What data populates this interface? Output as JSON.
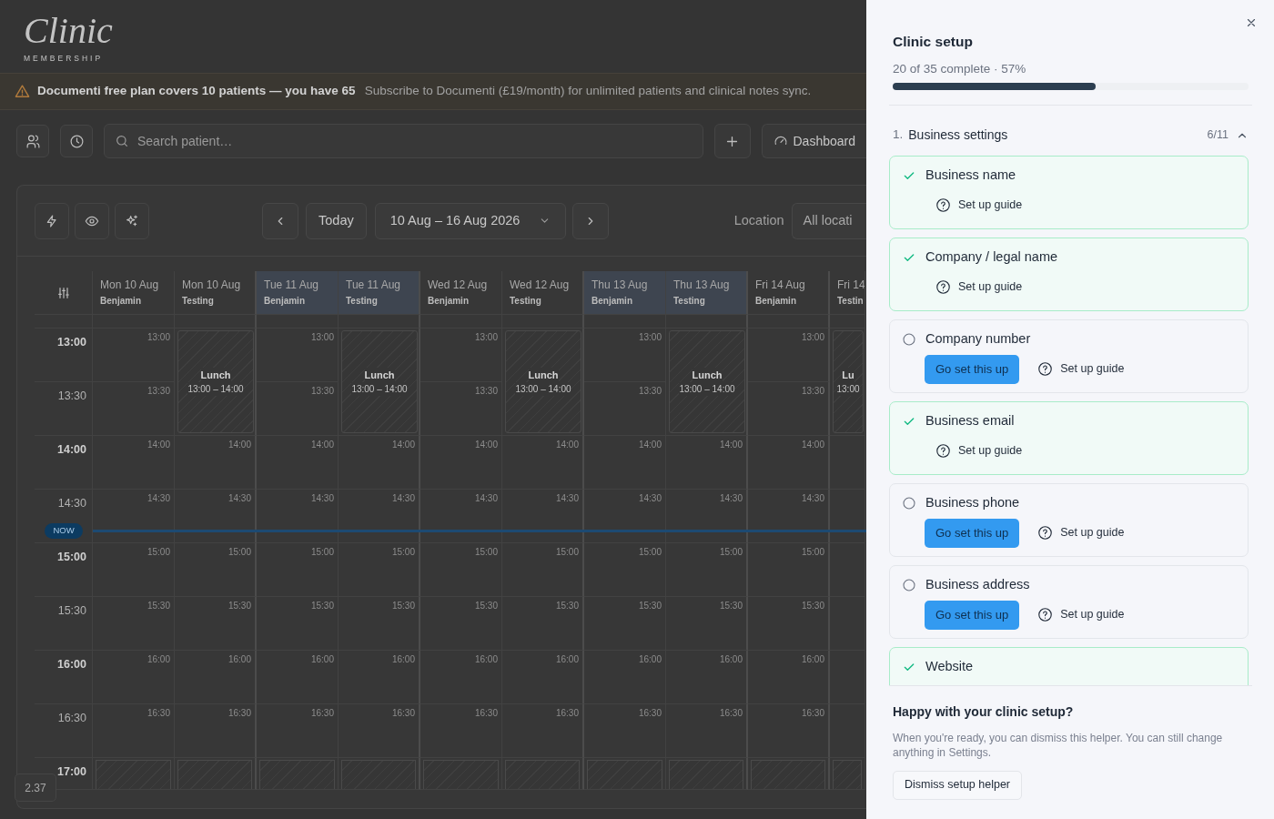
{
  "app": {
    "logo": "Clinic",
    "logo_subtitle": "MEMBERSHIP"
  },
  "banner": {
    "title": "Documenti free plan covers 10 patients — you have 65",
    "message": "Subscribe to Documenti (£19/month) for unlimited patients and clinical notes sync."
  },
  "toolbar": {
    "search": {
      "placeholder": "Search patient…"
    },
    "dashboard_button": "Dashboard"
  },
  "calendar": {
    "today_button": "Today",
    "date_range": "10 Aug – 16 Aug 2026",
    "location_label": "Location",
    "location_value": "All locati",
    "columns": [
      {
        "day": "Mon 10 Aug",
        "person": "Benjamin",
        "shaded": false
      },
      {
        "day": "Mon 10 Aug",
        "person": "Testing",
        "shaded": false
      },
      {
        "day": "Tue 11 Aug",
        "person": "Benjamin",
        "shaded": true
      },
      {
        "day": "Tue 11 Aug",
        "person": "Testing",
        "shaded": true
      },
      {
        "day": "Wed 12 Aug",
        "person": "Benjamin",
        "shaded": false
      },
      {
        "day": "Wed 12 Aug",
        "person": "Testing",
        "shaded": false
      },
      {
        "day": "Thu 13 Aug",
        "person": "Benjamin",
        "shaded": true
      },
      {
        "day": "Thu 13 Aug",
        "person": "Testing",
        "shaded": true
      },
      {
        "day": "Fri 14 Aug",
        "person": "Benjamin",
        "shaded": false
      },
      {
        "day": "Fri 14",
        "person": "Testin",
        "shaded": false
      }
    ],
    "rows": [
      {
        "time": "13:00",
        "major": true,
        "cells": [
          {
            "kind": "free",
            "label": "13:00"
          },
          {
            "kind": "event",
            "title": "Lunch",
            "time": "13:00 – 14:00"
          },
          {
            "kind": "free",
            "label": "13:00"
          },
          {
            "kind": "event",
            "title": "Lunch",
            "time": "13:00 – 14:00"
          },
          {
            "kind": "free",
            "label": "13:00"
          },
          {
            "kind": "event",
            "title": "Lunch",
            "time": "13:00 – 14:00"
          },
          {
            "kind": "free",
            "label": "13:00"
          },
          {
            "kind": "event",
            "title": "Lunch",
            "time": "13:00 – 14:00"
          },
          {
            "kind": "free",
            "label": "13:00"
          },
          {
            "kind": "event",
            "title": "Lu",
            "time": "13:00"
          }
        ]
      },
      {
        "time": "13:30",
        "major": false,
        "cells": [
          {
            "kind": "free",
            "label": "13:30"
          },
          {
            "kind": "covered"
          },
          {
            "kind": "free",
            "label": "13:30"
          },
          {
            "kind": "covered"
          },
          {
            "kind": "free",
            "label": "13:30"
          },
          {
            "kind": "covered"
          },
          {
            "kind": "free",
            "label": "13:30"
          },
          {
            "kind": "covered"
          },
          {
            "kind": "free",
            "label": "13:30"
          },
          {
            "kind": "covered"
          }
        ]
      },
      {
        "time": "14:00",
        "major": true,
        "cells": [
          {
            "kind": "free",
            "label": "14:00"
          },
          {
            "kind": "free",
            "label": "14:00"
          },
          {
            "kind": "free",
            "label": "14:00"
          },
          {
            "kind": "free",
            "label": "14:00"
          },
          {
            "kind": "free",
            "label": "14:00"
          },
          {
            "kind": "free",
            "label": "14:00"
          },
          {
            "kind": "free",
            "label": "14:00"
          },
          {
            "kind": "free",
            "label": "14:00"
          },
          {
            "kind": "free",
            "label": "14:00"
          },
          {
            "kind": "free"
          }
        ]
      },
      {
        "time": "14:30",
        "major": false,
        "now_marker": "NOW",
        "cells": [
          {
            "kind": "free",
            "label": "14:30"
          },
          {
            "kind": "free",
            "label": "14:30"
          },
          {
            "kind": "free",
            "label": "14:30"
          },
          {
            "kind": "free",
            "label": "14:30"
          },
          {
            "kind": "free",
            "label": "14:30"
          },
          {
            "kind": "free",
            "label": "14:30"
          },
          {
            "kind": "free",
            "label": "14:30"
          },
          {
            "kind": "free",
            "label": "14:30"
          },
          {
            "kind": "free",
            "label": "14:30"
          },
          {
            "kind": "free"
          }
        ]
      },
      {
        "time": "15:00",
        "major": true,
        "cells": [
          {
            "kind": "free",
            "label": "15:00"
          },
          {
            "kind": "free",
            "label": "15:00"
          },
          {
            "kind": "free",
            "label": "15:00"
          },
          {
            "kind": "free",
            "label": "15:00"
          },
          {
            "kind": "free",
            "label": "15:00"
          },
          {
            "kind": "free",
            "label": "15:00"
          },
          {
            "kind": "free",
            "label": "15:00"
          },
          {
            "kind": "free",
            "label": "15:00"
          },
          {
            "kind": "free",
            "label": "15:00"
          },
          {
            "kind": "free"
          }
        ]
      },
      {
        "time": "15:30",
        "major": false,
        "cells": [
          {
            "kind": "free",
            "label": "15:30"
          },
          {
            "kind": "free",
            "label": "15:30"
          },
          {
            "kind": "free",
            "label": "15:30"
          },
          {
            "kind": "free",
            "label": "15:30"
          },
          {
            "kind": "free",
            "label": "15:30"
          },
          {
            "kind": "free",
            "label": "15:30"
          },
          {
            "kind": "free",
            "label": "15:30"
          },
          {
            "kind": "free",
            "label": "15:30"
          },
          {
            "kind": "free",
            "label": "15:30"
          },
          {
            "kind": "free"
          }
        ]
      },
      {
        "time": "16:00",
        "major": true,
        "cells": [
          {
            "kind": "free",
            "label": "16:00"
          },
          {
            "kind": "free",
            "label": "16:00"
          },
          {
            "kind": "free",
            "label": "16:00"
          },
          {
            "kind": "free",
            "label": "16:00"
          },
          {
            "kind": "free",
            "label": "16:00"
          },
          {
            "kind": "free",
            "label": "16:00"
          },
          {
            "kind": "free",
            "label": "16:00"
          },
          {
            "kind": "free",
            "label": "16:00"
          },
          {
            "kind": "free",
            "label": "16:00"
          },
          {
            "kind": "free"
          }
        ]
      },
      {
        "time": "16:30",
        "major": false,
        "cells": [
          {
            "kind": "free",
            "label": "16:30"
          },
          {
            "kind": "free",
            "label": "16:30"
          },
          {
            "kind": "free",
            "label": "16:30"
          },
          {
            "kind": "free",
            "label": "16:30"
          },
          {
            "kind": "free",
            "label": "16:30"
          },
          {
            "kind": "free",
            "label": "16:30"
          },
          {
            "kind": "free",
            "label": "16:30"
          },
          {
            "kind": "free",
            "label": "16:30"
          },
          {
            "kind": "free",
            "label": "16:30"
          },
          {
            "kind": "free"
          }
        ]
      },
      {
        "time": "17:00",
        "major": true,
        "cells": [
          {
            "kind": "blocked"
          },
          {
            "kind": "blocked"
          },
          {
            "kind": "blocked"
          },
          {
            "kind": "blocked"
          },
          {
            "kind": "blocked"
          },
          {
            "kind": "blocked"
          },
          {
            "kind": "blocked"
          },
          {
            "kind": "blocked"
          },
          {
            "kind": "blocked"
          },
          {
            "kind": "blocked"
          }
        ]
      }
    ]
  },
  "version": "2.37",
  "setup": {
    "title": "Clinic setup",
    "progress_text": "20 of 35 complete · 57%",
    "level": 0.57,
    "sections": [
      {
        "number": "1.",
        "title": "Business settings",
        "count": "6/11",
        "expanded": true,
        "items": [
          {
            "label": "Business name",
            "done": true,
            "guide": "Set up guide"
          },
          {
            "label": "Company / legal name",
            "done": true,
            "guide": "Set up guide"
          },
          {
            "label": "Company number",
            "done": false,
            "action": "Go set this up",
            "guide": "Set up guide"
          },
          {
            "label": "Business email",
            "done": true,
            "guide": "Set up guide"
          },
          {
            "label": "Business phone",
            "done": false,
            "action": "Go set this up",
            "guide": "Set up guide"
          },
          {
            "label": "Business address",
            "done": false,
            "action": "Go set this up",
            "guide": "Set up guide"
          },
          {
            "label": "Website",
            "done": true
          }
        ]
      }
    ],
    "footer": {
      "heading": "Happy with your clinic setup?",
      "text": "When you're ready, you can dismiss this helper. You can still change anything in Settings.",
      "button": "Dismiss setup helper"
    }
  }
}
